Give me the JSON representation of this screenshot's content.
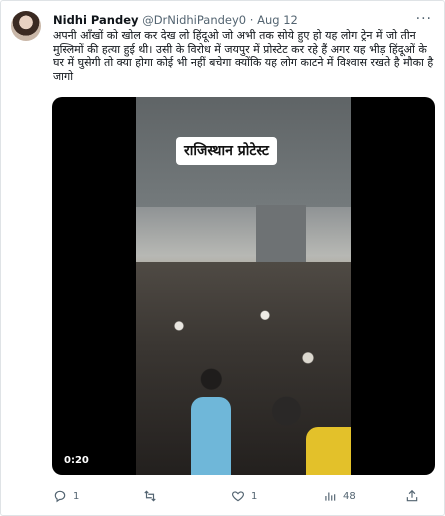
{
  "tweet": {
    "author_name": "Nidhi Pandey",
    "handle": "@DrNidhiPandey0",
    "separator": "·",
    "date": "Aug 12",
    "more_icon": "more-icon",
    "text": "अपनी आँखों को खोल कर देख लो हिंदूओ जो अभी तक सोये हुए हो यह लोग ट्रेन में जो तीन मुस्लिमों की हत्या हुई थी। उसी के विरोध में जयपुर में प्रोस्टेट कर रहे हैं अगर यह भीड़ हिंदूओं के घर में घुसेगी तो क्या होगा कोई भी नहीं बचेगा क्योंकि यह लोग काटने में विश्वास रखते है मौका है जागो"
  },
  "media": {
    "overlay_text": "राजिस्थान प्रोटेस्ट",
    "duration": "0:20"
  },
  "actions": {
    "reply": {
      "icon": "reply-icon",
      "count": "1"
    },
    "retweet": {
      "icon": "retweet-icon",
      "count": ""
    },
    "like": {
      "icon": "heart-icon",
      "count": "1"
    },
    "views": {
      "icon": "analytics-icon",
      "count": "48"
    },
    "share": {
      "icon": "share-icon"
    }
  },
  "colors": {
    "secondary_text": "#536471",
    "primary_text": "#0f1419",
    "border": "#dfe3e6"
  }
}
